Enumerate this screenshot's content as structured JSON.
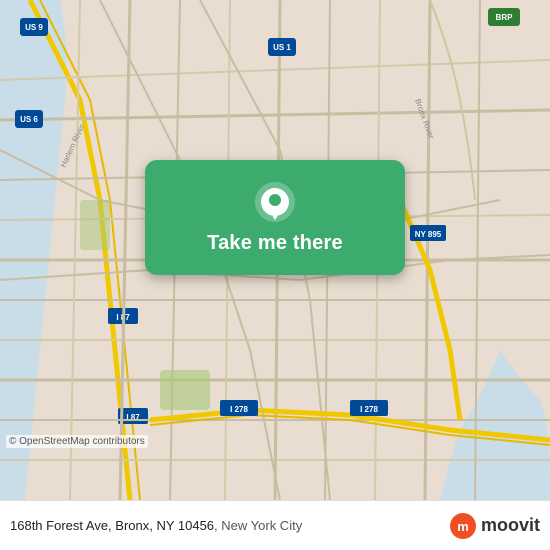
{
  "map": {
    "background_color": "#e8e0d8",
    "center_lat": 40.845,
    "center_lng": -73.92
  },
  "card": {
    "button_label": "Take me there",
    "background_color": "#3daa6e"
  },
  "bottom_bar": {
    "address": "168th Forest Ave, Bronx, NY 10456",
    "city": ", New York City",
    "copyright": "© OpenStreetMap contributors",
    "logo_text": "moovit"
  }
}
